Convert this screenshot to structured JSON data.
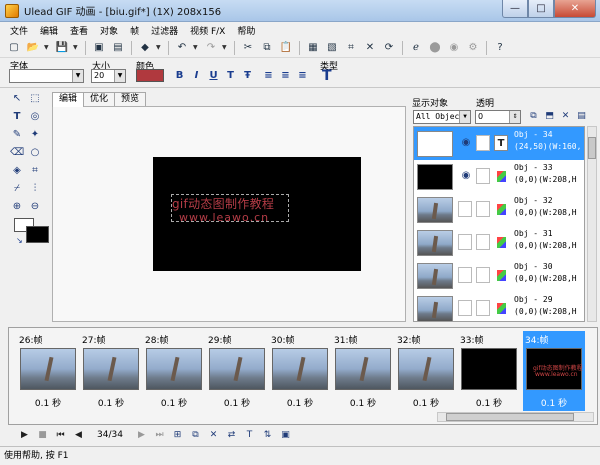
{
  "window": {
    "title": "Ulead GIF 动画 - [biu.gif*] (1X) 208x156",
    "minimize": "—",
    "maximize": "□",
    "close": "✕"
  },
  "menu": [
    "文件",
    "编辑",
    "查看",
    "对象",
    "帧",
    "过滤器",
    "视频 F/X",
    "帮助"
  ],
  "attributes": {
    "font_label": "字体",
    "size_label": "大小",
    "size_value": "20",
    "color_label": "颜色",
    "color_value": "#b0393e",
    "type_label": "类型"
  },
  "tabs": [
    "编辑",
    "优化",
    "预览"
  ],
  "canvas": {
    "line1": "gif动态图制作教程",
    "line2": "www.leawo.cn"
  },
  "object_panel": {
    "show_label": "显示对象",
    "opacity_label": "透明",
    "filter_value": "All Object:",
    "opacity_value": "0",
    "objects": [
      {
        "name": "Obj - 34",
        "info": "(24,50)(W:160,",
        "kind": "text",
        "selected": true
      },
      {
        "name": "Obj - 33",
        "info": "(0,0)(W:208,H",
        "kind": "black",
        "selected": false
      },
      {
        "name": "Obj - 32",
        "info": "(0,0)(W:208,H",
        "kind": "image",
        "selected": false
      },
      {
        "name": "Obj - 31",
        "info": "(0,0)(W:208,H",
        "kind": "image",
        "selected": false
      },
      {
        "name": "Obj - 30",
        "info": "(0,0)(W:208,H",
        "kind": "image",
        "selected": false
      },
      {
        "name": "Obj - 29",
        "info": "(0,0)(W:208,H",
        "kind": "image",
        "selected": false
      }
    ]
  },
  "frames": [
    {
      "label": "26:帧",
      "delay": "0.1 秒",
      "kind": "image"
    },
    {
      "label": "27:帧",
      "delay": "0.1 秒",
      "kind": "image"
    },
    {
      "label": "28:帧",
      "delay": "0.1 秒",
      "kind": "image"
    },
    {
      "label": "29:帧",
      "delay": "0.1 秒",
      "kind": "image"
    },
    {
      "label": "30:帧",
      "delay": "0.1 秒",
      "kind": "image"
    },
    {
      "label": "31:帧",
      "delay": "0.1 秒",
      "kind": "image"
    },
    {
      "label": "32:帧",
      "delay": "0.1 秒",
      "kind": "image"
    },
    {
      "label": "33:帧",
      "delay": "0.1 秒",
      "kind": "black"
    },
    {
      "label": "34:帧",
      "delay": "0.1 秒",
      "kind": "text",
      "selected": true
    }
  ],
  "mini_text": {
    "line1": "gif动态图制作教程",
    "line2": "www.leawo.cn"
  },
  "playback": {
    "counter": "34/34"
  },
  "status": "使用帮助, 按 F1"
}
